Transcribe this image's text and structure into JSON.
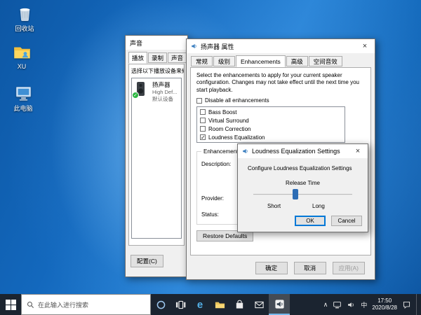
{
  "colors": {
    "accent": "#0078d7",
    "wallpaper_blue": "#1467be",
    "taskbar": "#1b2430",
    "default_device_green": "#2db742"
  },
  "glyphs": {
    "close": "×",
    "check": "✓",
    "chevron_up": "∧",
    "edge": "e"
  },
  "desktop": {
    "icons": [
      {
        "label": "回收站"
      },
      {
        "label": "XU"
      },
      {
        "label": "此电脑"
      }
    ]
  },
  "sound_dialog": {
    "title": "声音",
    "tabs": [
      "播放",
      "录制",
      "声音"
    ],
    "instruction": "选择以下播放设备来修",
    "device": {
      "name": "扬声器",
      "detail": "High Def...",
      "status": "默认设备",
      "check": "✓"
    },
    "configure_button": "配置(C)"
  },
  "properties_dialog": {
    "title": "扬声器 属性",
    "tabs": [
      "常规",
      "级别",
      "Enhancements",
      "高级",
      "空间音效"
    ],
    "intro": "Select the enhancements to apply for your current speaker configuration. Changes may not take effect until the next time you start playback.",
    "disable_all": {
      "label": "Disable all enhancements",
      "check": ""
    },
    "enhancements": [
      {
        "label": "Bass Boost",
        "check": ""
      },
      {
        "label": "Virtual Surround",
        "check": ""
      },
      {
        "label": "Room Correction",
        "check": ""
      },
      {
        "label": "Loudness Equalization",
        "check": "✓"
      }
    ],
    "properties_group": {
      "title": "Enhancement Properties",
      "description_label": "Description:",
      "provider_label": "Provider:",
      "status_label": "Status:"
    },
    "restore_defaults_button": "Restore Defaults",
    "ok_button": "确定",
    "cancel_button": "取消",
    "apply_button": "应用(A)"
  },
  "loudness_dialog": {
    "title": "Loudness Equalization Settings",
    "instruction": "Configure Loudness Equalization Settings",
    "slider_label": "Release Time",
    "min_label": "Short",
    "max_label": "Long",
    "ok_button": "OK",
    "cancel_button": "Cancel"
  },
  "taskbar": {
    "search_placeholder": "在此输入进行搜索",
    "tray": {
      "ime": "中",
      "time": "17:50",
      "date": "2020/8/28"
    }
  }
}
